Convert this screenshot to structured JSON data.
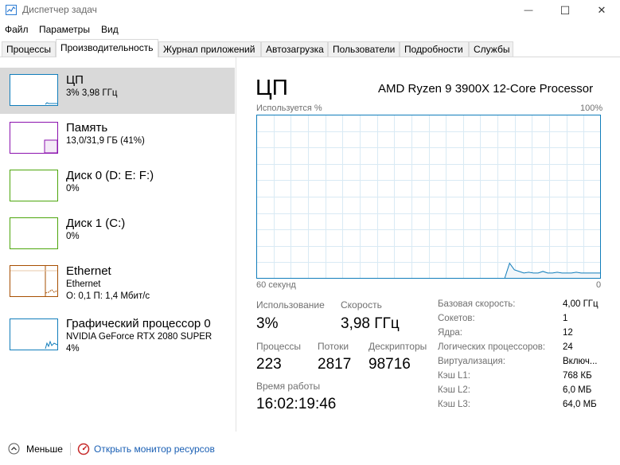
{
  "window": {
    "title": "Диспетчер задач",
    "minimize_glyph": "—",
    "maximize_glyph": "☐",
    "close_glyph": "✕"
  },
  "menu": [
    "Файл",
    "Параметры",
    "Вид"
  ],
  "tabs": [
    "Процессы",
    "Производительность",
    "Журнал приложений",
    "Автозагрузка",
    "Пользователи",
    "Подробности",
    "Службы"
  ],
  "active_tab": "Производительность",
  "sidebar": {
    "items": [
      {
        "title": "ЦП",
        "line1": "3% 3,98 ГГц",
        "line2": "",
        "color": "#117dbb",
        "selected": true
      },
      {
        "title": "Память",
        "line1": "13,0/31,9 ГБ (41%)",
        "line2": "",
        "color": "#8b12ae",
        "selected": false
      },
      {
        "title": "Диск 0 (D: E: F:)",
        "line1": "0%",
        "line2": "",
        "color": "#4da60c",
        "selected": false
      },
      {
        "title": "Диск 1 (C:)",
        "line1": "0%",
        "line2": "",
        "color": "#4da60c",
        "selected": false
      },
      {
        "title": "Ethernet",
        "line1": "Ethernet",
        "line2": "О: 0,1 П: 1,4 Мбит/с",
        "color": "#a74f01",
        "selected": false
      },
      {
        "title": "Графический процессор 0",
        "line1": "NVIDIA GeForce RTX 2080 SUPER",
        "line2": "4%",
        "color": "#117dbb",
        "selected": false
      }
    ]
  },
  "main": {
    "title": "ЦП",
    "cpu_model": "AMD Ryzen 9 3900X 12-Core Processor",
    "graph": {
      "y_label": "Используется %",
      "y_max_label": "100%",
      "x_left_label": "60 секунд",
      "x_right_label": "0",
      "line_color": "#117dbb",
      "fill_color": "#f1f6fa",
      "usage_points": [
        0,
        0,
        0,
        0,
        0,
        0,
        0,
        0,
        0,
        0,
        0,
        0,
        0,
        0,
        0,
        0,
        0,
        0,
        0,
        0,
        0,
        0,
        0,
        0,
        0,
        0,
        0,
        0,
        0,
        0,
        0,
        0,
        0,
        0,
        0,
        0,
        0,
        0,
        0,
        0,
        0,
        0,
        0,
        0,
        0,
        0,
        0,
        0,
        0,
        0,
        0,
        0,
        0,
        9,
        5,
        4,
        3,
        3.5,
        3,
        3,
        4,
        3,
        3,
        3.5,
        3,
        3,
        3,
        3.5,
        3,
        3,
        3,
        3,
        3
      ]
    },
    "stats": {
      "usage_label": "Использование",
      "usage_value": "3%",
      "speed_label": "Скорость",
      "speed_value": "3,98 ГГц",
      "processes_label": "Процессы",
      "processes_value": "223",
      "threads_label": "Потоки",
      "threads_value": "2817",
      "handles_label": "Дескрипторы",
      "handles_value": "98716",
      "uptime_label": "Время работы",
      "uptime_value": "16:02:19:46"
    },
    "specs": [
      {
        "label": "Базовая скорость:",
        "value": "4,00 ГГц"
      },
      {
        "label": "Сокетов:",
        "value": "1"
      },
      {
        "label": "Ядра:",
        "value": "12"
      },
      {
        "label": "Логических процессоров:",
        "value": "24"
      },
      {
        "label": "Виртуализация:",
        "value": "Включ..."
      },
      {
        "label": "Кэш L1:",
        "value": "768 КБ"
      },
      {
        "label": "Кэш L2:",
        "value": "6,0 МБ"
      },
      {
        "label": "Кэш L3:",
        "value": "64,0 МБ"
      }
    ]
  },
  "footer": {
    "less_label": "Меньше",
    "resource_monitor_label": "Открыть монитор ресурсов"
  }
}
